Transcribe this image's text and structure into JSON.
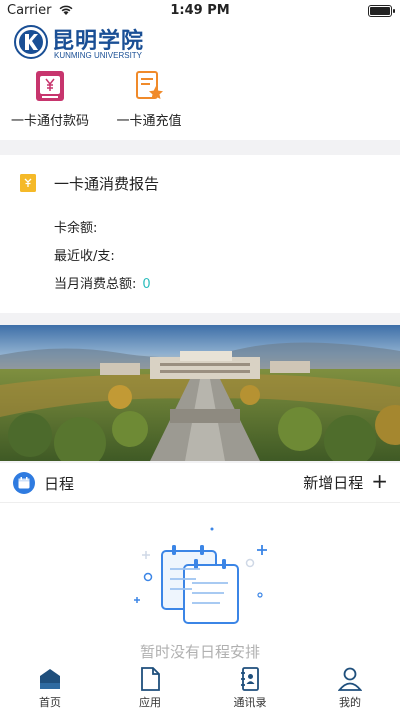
{
  "status_bar": {
    "carrier": "Carrier",
    "time": "1:49 PM",
    "battery_level": 1.0
  },
  "header": {
    "logo_cn": "昆明学院",
    "logo_en": "KUNMING UNIVERSITY",
    "brand_color": "#1a4f95",
    "quick_actions": [
      {
        "label": "一卡通付款码",
        "icon": "payment-qr-icon",
        "color": "#c7356d"
      },
      {
        "label": "一卡通充值",
        "icon": "card-recharge-icon",
        "color": "#f08a2a"
      }
    ]
  },
  "report": {
    "icon": "receipt-icon",
    "title": "一卡通消费报告",
    "balance_label": "卡余额:",
    "recent_label": "最近收/支:",
    "monthly_label": "当月消费总额:",
    "monthly_value": "0",
    "value_color": "#2bbdbd"
  },
  "banner": {
    "image": "campus-aerial-photo"
  },
  "schedule": {
    "icon": "calendar-icon",
    "title": "日程",
    "add_label": "新增日程",
    "add_icon": "plus-icon",
    "empty_text": "暂时没有日程安排",
    "accent": "#2f7be0"
  },
  "tabbar": {
    "tabs": [
      {
        "label": "首页",
        "icon": "home-icon",
        "active": true
      },
      {
        "label": "应用",
        "icon": "apps-document-icon",
        "active": false
      },
      {
        "label": "通讯录",
        "icon": "contacts-book-icon",
        "active": false
      },
      {
        "label": "我的",
        "icon": "profile-person-icon",
        "active": false
      }
    ]
  }
}
